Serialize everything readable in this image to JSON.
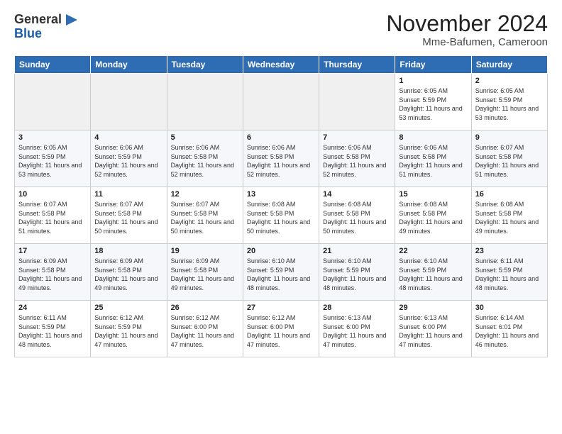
{
  "header": {
    "logo_line1": "General",
    "logo_line2": "Blue",
    "month_title": "November 2024",
    "location": "Mme-Bafumen, Cameroon"
  },
  "weekdays": [
    "Sunday",
    "Monday",
    "Tuesday",
    "Wednesday",
    "Thursday",
    "Friday",
    "Saturday"
  ],
  "weeks": [
    [
      {
        "day": "",
        "empty": true
      },
      {
        "day": "",
        "empty": true
      },
      {
        "day": "",
        "empty": true
      },
      {
        "day": "",
        "empty": true
      },
      {
        "day": "",
        "empty": true
      },
      {
        "day": "1",
        "sunrise": "6:05 AM",
        "sunset": "5:59 PM",
        "daylight": "11 hours and 53 minutes."
      },
      {
        "day": "2",
        "sunrise": "6:05 AM",
        "sunset": "5:59 PM",
        "daylight": "11 hours and 53 minutes."
      }
    ],
    [
      {
        "day": "3",
        "sunrise": "6:05 AM",
        "sunset": "5:59 PM",
        "daylight": "11 hours and 53 minutes."
      },
      {
        "day": "4",
        "sunrise": "6:06 AM",
        "sunset": "5:59 PM",
        "daylight": "11 hours and 52 minutes."
      },
      {
        "day": "5",
        "sunrise": "6:06 AM",
        "sunset": "5:58 PM",
        "daylight": "11 hours and 52 minutes."
      },
      {
        "day": "6",
        "sunrise": "6:06 AM",
        "sunset": "5:58 PM",
        "daylight": "11 hours and 52 minutes."
      },
      {
        "day": "7",
        "sunrise": "6:06 AM",
        "sunset": "5:58 PM",
        "daylight": "11 hours and 52 minutes."
      },
      {
        "day": "8",
        "sunrise": "6:06 AM",
        "sunset": "5:58 PM",
        "daylight": "11 hours and 51 minutes."
      },
      {
        "day": "9",
        "sunrise": "6:07 AM",
        "sunset": "5:58 PM",
        "daylight": "11 hours and 51 minutes."
      }
    ],
    [
      {
        "day": "10",
        "sunrise": "6:07 AM",
        "sunset": "5:58 PM",
        "daylight": "11 hours and 51 minutes."
      },
      {
        "day": "11",
        "sunrise": "6:07 AM",
        "sunset": "5:58 PM",
        "daylight": "11 hours and 50 minutes."
      },
      {
        "day": "12",
        "sunrise": "6:07 AM",
        "sunset": "5:58 PM",
        "daylight": "11 hours and 50 minutes."
      },
      {
        "day": "13",
        "sunrise": "6:08 AM",
        "sunset": "5:58 PM",
        "daylight": "11 hours and 50 minutes."
      },
      {
        "day": "14",
        "sunrise": "6:08 AM",
        "sunset": "5:58 PM",
        "daylight": "11 hours and 50 minutes."
      },
      {
        "day": "15",
        "sunrise": "6:08 AM",
        "sunset": "5:58 PM",
        "daylight": "11 hours and 49 minutes."
      },
      {
        "day": "16",
        "sunrise": "6:08 AM",
        "sunset": "5:58 PM",
        "daylight": "11 hours and 49 minutes."
      }
    ],
    [
      {
        "day": "17",
        "sunrise": "6:09 AM",
        "sunset": "5:58 PM",
        "daylight": "11 hours and 49 minutes."
      },
      {
        "day": "18",
        "sunrise": "6:09 AM",
        "sunset": "5:58 PM",
        "daylight": "11 hours and 49 minutes."
      },
      {
        "day": "19",
        "sunrise": "6:09 AM",
        "sunset": "5:58 PM",
        "daylight": "11 hours and 49 minutes."
      },
      {
        "day": "20",
        "sunrise": "6:10 AM",
        "sunset": "5:59 PM",
        "daylight": "11 hours and 48 minutes."
      },
      {
        "day": "21",
        "sunrise": "6:10 AM",
        "sunset": "5:59 PM",
        "daylight": "11 hours and 48 minutes."
      },
      {
        "day": "22",
        "sunrise": "6:10 AM",
        "sunset": "5:59 PM",
        "daylight": "11 hours and 48 minutes."
      },
      {
        "day": "23",
        "sunrise": "6:11 AM",
        "sunset": "5:59 PM",
        "daylight": "11 hours and 48 minutes."
      }
    ],
    [
      {
        "day": "24",
        "sunrise": "6:11 AM",
        "sunset": "5:59 PM",
        "daylight": "11 hours and 48 minutes."
      },
      {
        "day": "25",
        "sunrise": "6:12 AM",
        "sunset": "5:59 PM",
        "daylight": "11 hours and 47 minutes."
      },
      {
        "day": "26",
        "sunrise": "6:12 AM",
        "sunset": "6:00 PM",
        "daylight": "11 hours and 47 minutes."
      },
      {
        "day": "27",
        "sunrise": "6:12 AM",
        "sunset": "6:00 PM",
        "daylight": "11 hours and 47 minutes."
      },
      {
        "day": "28",
        "sunrise": "6:13 AM",
        "sunset": "6:00 PM",
        "daylight": "11 hours and 47 minutes."
      },
      {
        "day": "29",
        "sunrise": "6:13 AM",
        "sunset": "6:00 PM",
        "daylight": "11 hours and 47 minutes."
      },
      {
        "day": "30",
        "sunrise": "6:14 AM",
        "sunset": "6:01 PM",
        "daylight": "11 hours and 46 minutes."
      }
    ]
  ],
  "labels": {
    "sunrise_prefix": "Sunrise: ",
    "sunset_prefix": "Sunset: ",
    "daylight_prefix": "Daylight: "
  }
}
